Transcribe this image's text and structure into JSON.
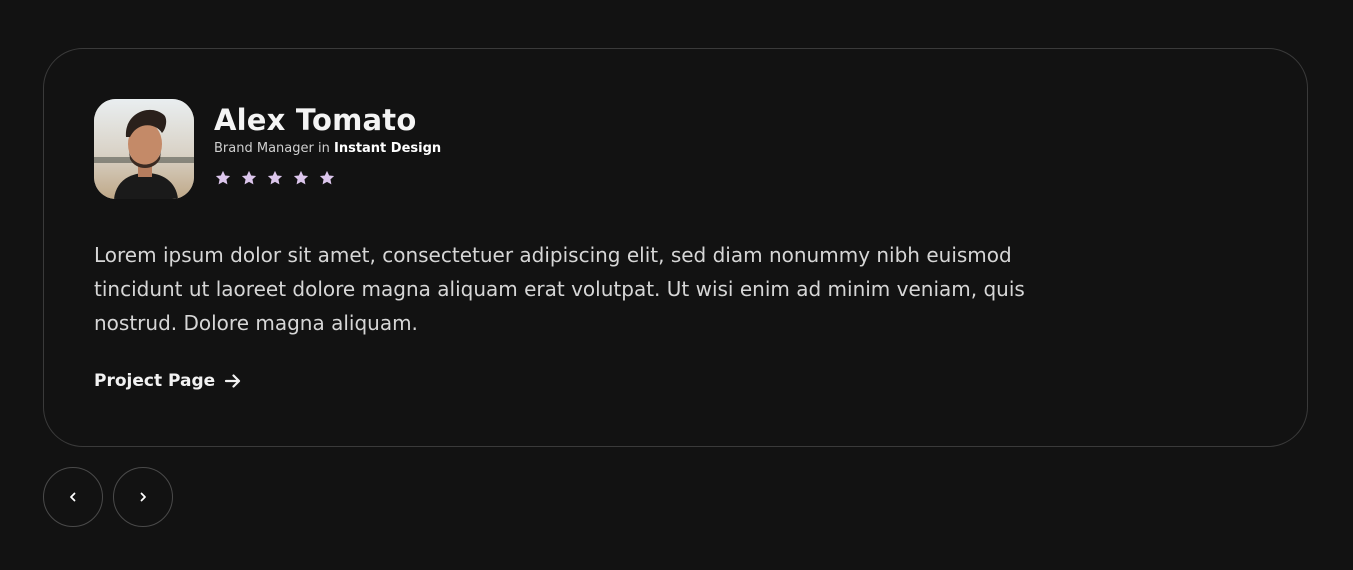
{
  "testimonial": {
    "name": "Alex Tomato",
    "role": "Brand Manager",
    "role_connector": "in",
    "company": "Instant Design",
    "rating": 5,
    "rating_max": 5,
    "quote": "Lorem ipsum dolor sit amet, consectetuer adipiscing elit, sed diam nonummy nibh euismod tincidunt ut laoreet dolore magna aliquam erat volutpat. Ut wisi enim ad minim veniam, quis nostrud. Dolore magna aliquam.",
    "link_label": "Project Page",
    "link_icon": "arrow-right-icon"
  },
  "navigation": {
    "prev_icon": "chevron-left-icon",
    "next_icon": "chevron-right-icon"
  },
  "colors": {
    "background": "#121212",
    "card_border": "#3a3a3a",
    "star": "#dcc6ec",
    "text": "#f4f4f4",
    "muted_text": "#d6d6d6"
  }
}
